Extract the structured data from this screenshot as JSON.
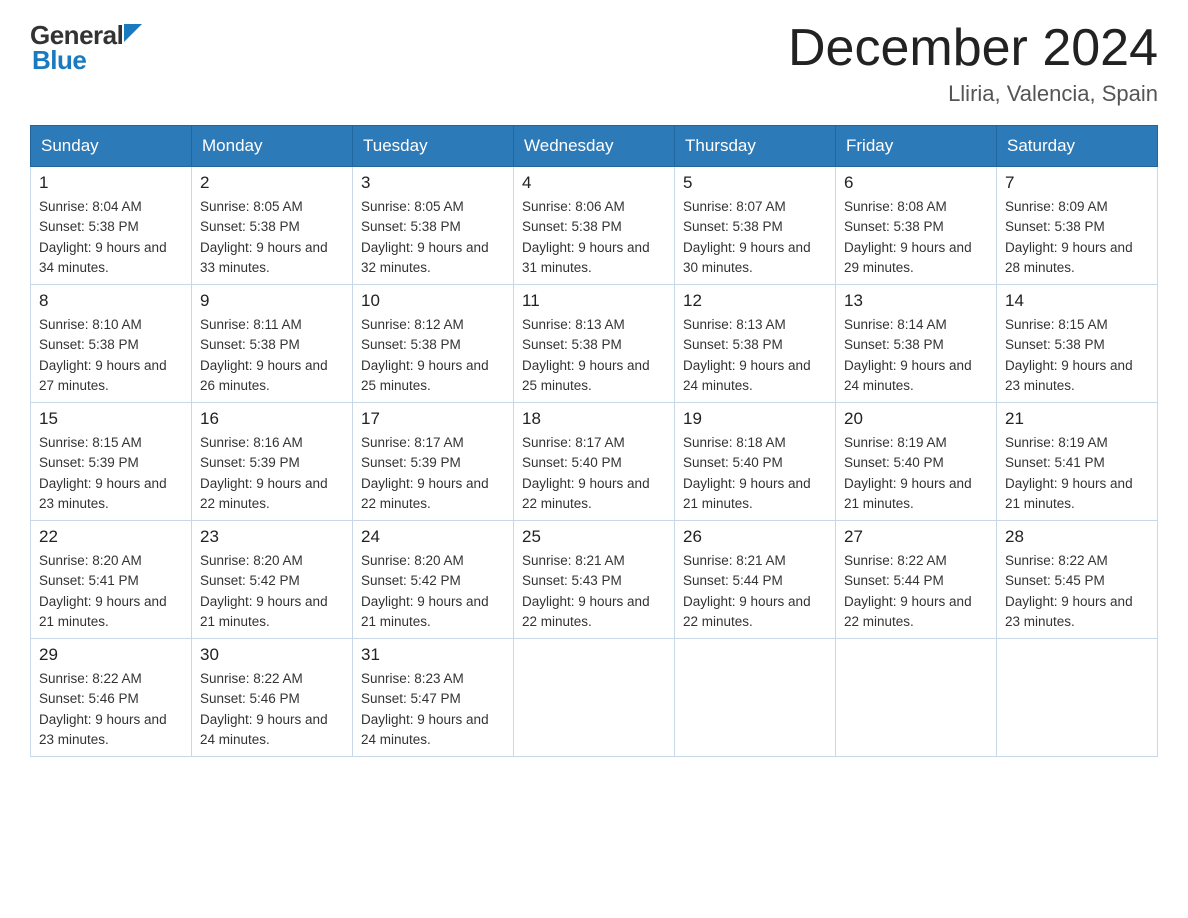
{
  "header": {
    "logo_general": "General",
    "logo_blue": "Blue",
    "title": "December 2024",
    "subtitle": "Lliria, Valencia, Spain"
  },
  "days": [
    "Sunday",
    "Monday",
    "Tuesday",
    "Wednesday",
    "Thursday",
    "Friday",
    "Saturday"
  ],
  "weeks": [
    [
      {
        "day": "1",
        "sunrise": "8:04 AM",
        "sunset": "5:38 PM",
        "daylight": "9 hours and 34 minutes."
      },
      {
        "day": "2",
        "sunrise": "8:05 AM",
        "sunset": "5:38 PM",
        "daylight": "9 hours and 33 minutes."
      },
      {
        "day": "3",
        "sunrise": "8:05 AM",
        "sunset": "5:38 PM",
        "daylight": "9 hours and 32 minutes."
      },
      {
        "day": "4",
        "sunrise": "8:06 AM",
        "sunset": "5:38 PM",
        "daylight": "9 hours and 31 minutes."
      },
      {
        "day": "5",
        "sunrise": "8:07 AM",
        "sunset": "5:38 PM",
        "daylight": "9 hours and 30 minutes."
      },
      {
        "day": "6",
        "sunrise": "8:08 AM",
        "sunset": "5:38 PM",
        "daylight": "9 hours and 29 minutes."
      },
      {
        "day": "7",
        "sunrise": "8:09 AM",
        "sunset": "5:38 PM",
        "daylight": "9 hours and 28 minutes."
      }
    ],
    [
      {
        "day": "8",
        "sunrise": "8:10 AM",
        "sunset": "5:38 PM",
        "daylight": "9 hours and 27 minutes."
      },
      {
        "day": "9",
        "sunrise": "8:11 AM",
        "sunset": "5:38 PM",
        "daylight": "9 hours and 26 minutes."
      },
      {
        "day": "10",
        "sunrise": "8:12 AM",
        "sunset": "5:38 PM",
        "daylight": "9 hours and 25 minutes."
      },
      {
        "day": "11",
        "sunrise": "8:13 AM",
        "sunset": "5:38 PM",
        "daylight": "9 hours and 25 minutes."
      },
      {
        "day": "12",
        "sunrise": "8:13 AM",
        "sunset": "5:38 PM",
        "daylight": "9 hours and 24 minutes."
      },
      {
        "day": "13",
        "sunrise": "8:14 AM",
        "sunset": "5:38 PM",
        "daylight": "9 hours and 24 minutes."
      },
      {
        "day": "14",
        "sunrise": "8:15 AM",
        "sunset": "5:38 PM",
        "daylight": "9 hours and 23 minutes."
      }
    ],
    [
      {
        "day": "15",
        "sunrise": "8:15 AM",
        "sunset": "5:39 PM",
        "daylight": "9 hours and 23 minutes."
      },
      {
        "day": "16",
        "sunrise": "8:16 AM",
        "sunset": "5:39 PM",
        "daylight": "9 hours and 22 minutes."
      },
      {
        "day": "17",
        "sunrise": "8:17 AM",
        "sunset": "5:39 PM",
        "daylight": "9 hours and 22 minutes."
      },
      {
        "day": "18",
        "sunrise": "8:17 AM",
        "sunset": "5:40 PM",
        "daylight": "9 hours and 22 minutes."
      },
      {
        "day": "19",
        "sunrise": "8:18 AM",
        "sunset": "5:40 PM",
        "daylight": "9 hours and 21 minutes."
      },
      {
        "day": "20",
        "sunrise": "8:19 AM",
        "sunset": "5:40 PM",
        "daylight": "9 hours and 21 minutes."
      },
      {
        "day": "21",
        "sunrise": "8:19 AM",
        "sunset": "5:41 PM",
        "daylight": "9 hours and 21 minutes."
      }
    ],
    [
      {
        "day": "22",
        "sunrise": "8:20 AM",
        "sunset": "5:41 PM",
        "daylight": "9 hours and 21 minutes."
      },
      {
        "day": "23",
        "sunrise": "8:20 AM",
        "sunset": "5:42 PM",
        "daylight": "9 hours and 21 minutes."
      },
      {
        "day": "24",
        "sunrise": "8:20 AM",
        "sunset": "5:42 PM",
        "daylight": "9 hours and 21 minutes."
      },
      {
        "day": "25",
        "sunrise": "8:21 AM",
        "sunset": "5:43 PM",
        "daylight": "9 hours and 22 minutes."
      },
      {
        "day": "26",
        "sunrise": "8:21 AM",
        "sunset": "5:44 PM",
        "daylight": "9 hours and 22 minutes."
      },
      {
        "day": "27",
        "sunrise": "8:22 AM",
        "sunset": "5:44 PM",
        "daylight": "9 hours and 22 minutes."
      },
      {
        "day": "28",
        "sunrise": "8:22 AM",
        "sunset": "5:45 PM",
        "daylight": "9 hours and 23 minutes."
      }
    ],
    [
      {
        "day": "29",
        "sunrise": "8:22 AM",
        "sunset": "5:46 PM",
        "daylight": "9 hours and 23 minutes."
      },
      {
        "day": "30",
        "sunrise": "8:22 AM",
        "sunset": "5:46 PM",
        "daylight": "9 hours and 24 minutes."
      },
      {
        "day": "31",
        "sunrise": "8:23 AM",
        "sunset": "5:47 PM",
        "daylight": "9 hours and 24 minutes."
      },
      null,
      null,
      null,
      null
    ]
  ]
}
